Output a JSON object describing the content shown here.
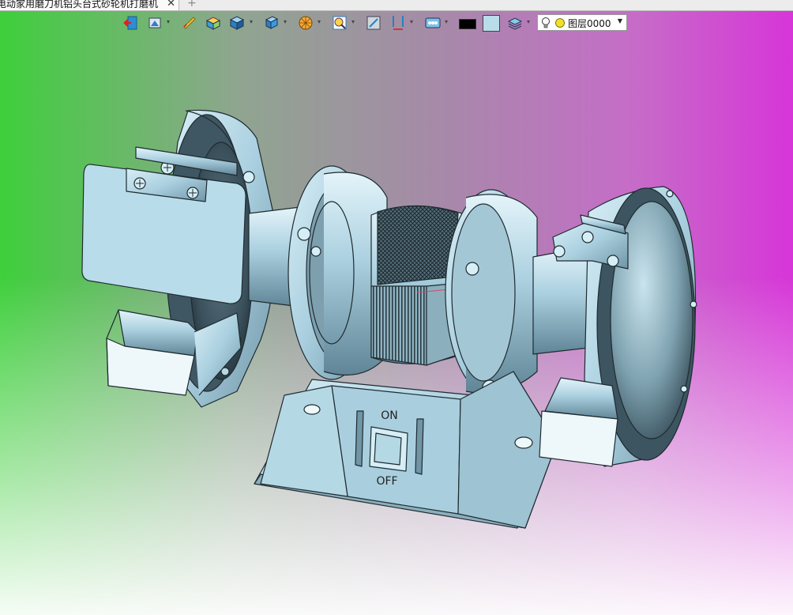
{
  "document_tab": {
    "title": "电动家用磨刀机铝头台式砂轮机打磨机",
    "close_glyph": "✕",
    "new_tab_glyph": "+"
  },
  "toolbar": {
    "tools": [
      "exit-sketch-icon",
      "view-orientation-icon",
      "measure-icon",
      "shaded-box-icon",
      "display-mode-cube-icon",
      "standard-views-icon",
      "render-style-icon",
      "zoom-fit-icon",
      "section-view-icon",
      "dimension-icon",
      "display-settings-icon",
      "layer-manager-icon"
    ],
    "dropdown_glyph": "▾",
    "colors": {
      "line_color": "#000000",
      "fill_color": "#b8dcea"
    },
    "layer": {
      "value": "图层0000",
      "arrow_glyph": "▼"
    }
  },
  "model_labels": {
    "switch_on": "ON",
    "switch_off": "OFF"
  },
  "colors": {
    "part_fill": "#a9cfdf",
    "part_edge": "#1f2b30",
    "dark_face": "#3d5561",
    "viewport_left": "#3fcf3c",
    "viewport_right": "#d735d8"
  }
}
